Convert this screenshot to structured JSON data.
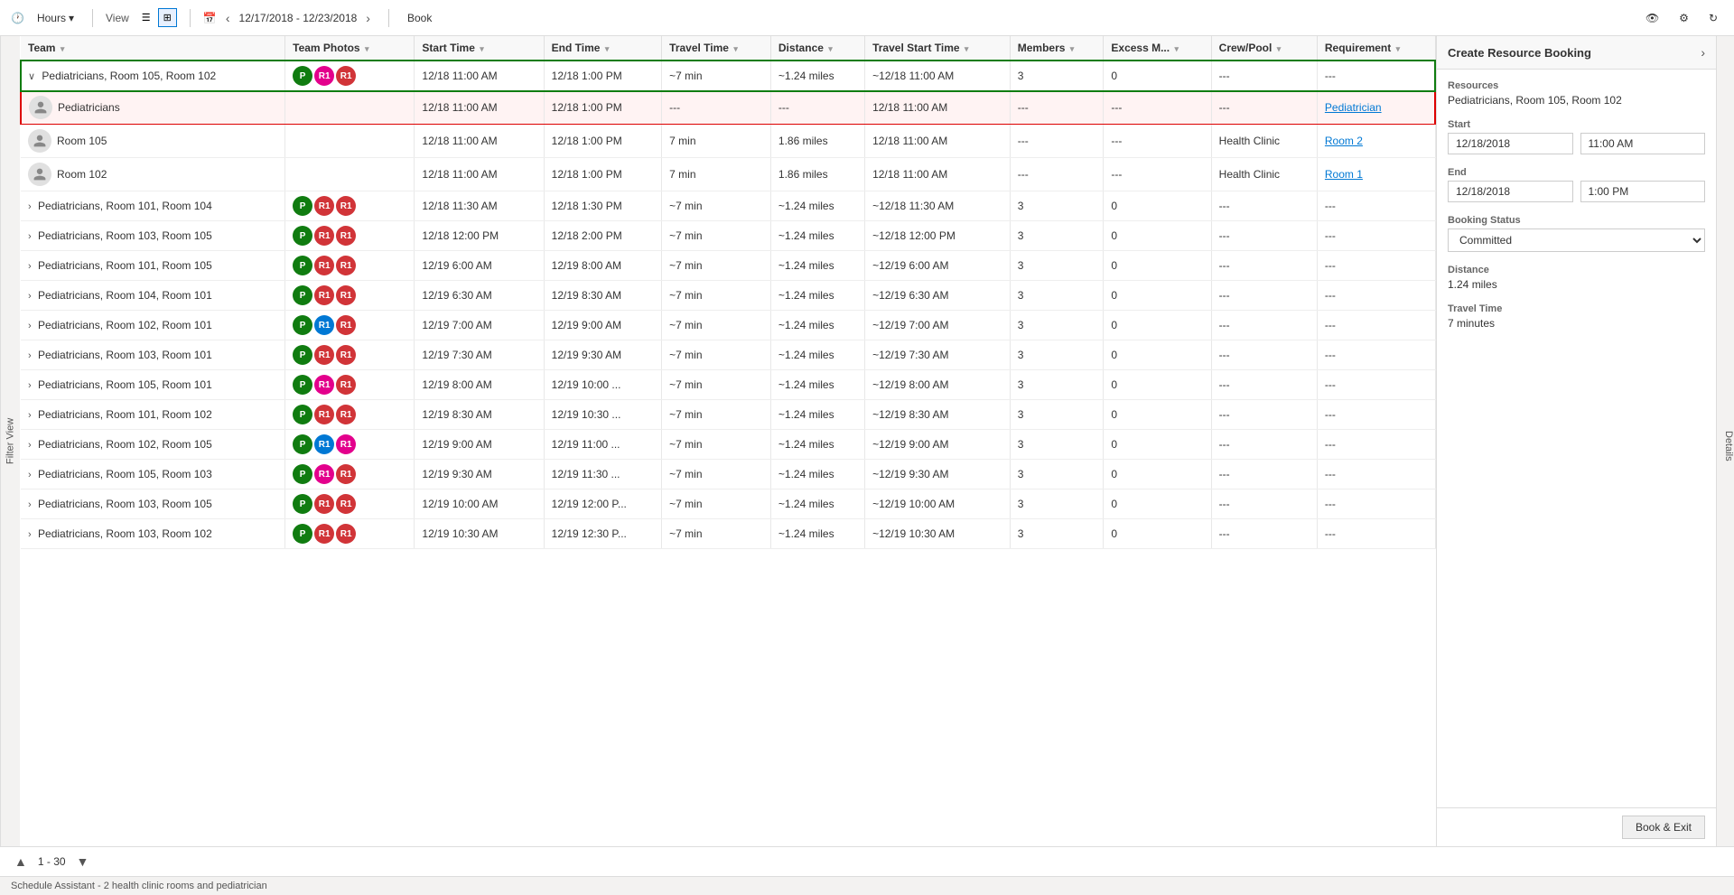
{
  "toolbar": {
    "hours_label": "Hours",
    "view_label": "View",
    "date_range": "12/17/2018 - 12/23/2018",
    "book_label": "Book",
    "eye_icon": "👁",
    "gear_icon": "⚙",
    "refresh_icon": "↻"
  },
  "side_label": "Filter View",
  "columns": [
    {
      "key": "team",
      "label": "Team"
    },
    {
      "key": "photos",
      "label": "Team Photos"
    },
    {
      "key": "start",
      "label": "Start Time"
    },
    {
      "key": "end",
      "label": "End Time"
    },
    {
      "key": "travel",
      "label": "Travel Time"
    },
    {
      "key": "distance",
      "label": "Distance"
    },
    {
      "key": "tstart",
      "label": "Travel Start Time"
    },
    {
      "key": "members",
      "label": "Members"
    },
    {
      "key": "excess",
      "label": "Excess M..."
    },
    {
      "key": "crew",
      "label": "Crew/Pool"
    },
    {
      "key": "req",
      "label": "Requirement"
    }
  ],
  "rows": [
    {
      "id": "row1",
      "type": "group-header",
      "expanded": true,
      "selected": false,
      "team": "Pediatricians, Room 105, Room 102",
      "avatars": [
        {
          "letter": "P",
          "class": "av-green"
        },
        {
          "letter": "R1",
          "class": "av-pink"
        },
        {
          "letter": "R1",
          "class": "av-red"
        }
      ],
      "start": "12/18 11:00 AM",
      "end": "12/18 1:00 PM",
      "travel": "~7 min",
      "distance": "~1.24 miles",
      "tstart": "~12/18 11:00 AM",
      "members": "3",
      "excess": "0",
      "crew": "---",
      "req": "---"
    },
    {
      "id": "row1a",
      "type": "child",
      "selected": true,
      "team": "Pediatricians",
      "avatars": [],
      "avatar_person": true,
      "start": "12/18 11:00 AM",
      "end": "12/18 1:00 PM",
      "travel": "---",
      "distance": "---",
      "tstart": "12/18 11:00 AM",
      "members": "---",
      "excess": "---",
      "crew": "---",
      "req": "Pediatrician",
      "req_link": true
    },
    {
      "id": "row1b",
      "type": "child",
      "selected": false,
      "team": "Room 105",
      "avatars": [],
      "avatar_person": true,
      "start": "12/18 11:00 AM",
      "end": "12/18 1:00 PM",
      "travel": "7 min",
      "distance": "1.86 miles",
      "tstart": "12/18 11:00 AM",
      "members": "---",
      "excess": "---",
      "crew": "Health Clinic",
      "req": "Room 2",
      "req_link": true
    },
    {
      "id": "row1c",
      "type": "child",
      "selected": false,
      "team": "Room 102",
      "avatars": [],
      "avatar_person": true,
      "start": "12/18 11:00 AM",
      "end": "12/18 1:00 PM",
      "travel": "7 min",
      "distance": "1.86 miles",
      "tstart": "12/18 11:00 AM",
      "members": "---",
      "excess": "---",
      "crew": "Health Clinic",
      "req": "Room 1",
      "req_link": true
    },
    {
      "id": "row2",
      "type": "group-header",
      "expanded": false,
      "selected": false,
      "team": "Pediatricians, Room 101, Room 104",
      "avatars": [
        {
          "letter": "P",
          "class": "av-green"
        },
        {
          "letter": "R1",
          "class": "av-red"
        },
        {
          "letter": "R1",
          "class": "av-red"
        }
      ],
      "start": "12/18 11:30 AM",
      "end": "12/18 1:30 PM",
      "travel": "~7 min",
      "distance": "~1.24 miles",
      "tstart": "~12/18 11:30 AM",
      "members": "3",
      "excess": "0",
      "crew": "---",
      "req": "---"
    },
    {
      "id": "row3",
      "type": "group-header",
      "expanded": false,
      "selected": false,
      "team": "Pediatricians, Room 103, Room 105",
      "avatars": [
        {
          "letter": "P",
          "class": "av-green"
        },
        {
          "letter": "R1",
          "class": "av-red"
        },
        {
          "letter": "R1",
          "class": "av-red"
        }
      ],
      "start": "12/18 12:00 PM",
      "end": "12/18 2:00 PM",
      "travel": "~7 min",
      "distance": "~1.24 miles",
      "tstart": "~12/18 12:00 PM",
      "members": "3",
      "excess": "0",
      "crew": "---",
      "req": "---"
    },
    {
      "id": "row4",
      "type": "group-header",
      "expanded": false,
      "selected": false,
      "team": "Pediatricians, Room 101, Room 105",
      "avatars": [
        {
          "letter": "P",
          "class": "av-green"
        },
        {
          "letter": "R1",
          "class": "av-red"
        },
        {
          "letter": "R1",
          "class": "av-red"
        }
      ],
      "start": "12/19 6:00 AM",
      "end": "12/19 8:00 AM",
      "travel": "~7 min",
      "distance": "~1.24 miles",
      "tstart": "~12/19 6:00 AM",
      "members": "3",
      "excess": "0",
      "crew": "---",
      "req": "---"
    },
    {
      "id": "row5",
      "type": "group-header",
      "expanded": false,
      "selected": false,
      "team": "Pediatricians, Room 104, Room 101",
      "avatars": [
        {
          "letter": "P",
          "class": "av-green"
        },
        {
          "letter": "R1",
          "class": "av-red"
        },
        {
          "letter": "R1",
          "class": "av-red"
        }
      ],
      "start": "12/19 6:30 AM",
      "end": "12/19 8:30 AM",
      "travel": "~7 min",
      "distance": "~1.24 miles",
      "tstart": "~12/19 6:30 AM",
      "members": "3",
      "excess": "0",
      "crew": "---",
      "req": "---"
    },
    {
      "id": "row6",
      "type": "group-header",
      "expanded": false,
      "selected": false,
      "team": "Pediatricians, Room 102, Room 101",
      "avatars": [
        {
          "letter": "P",
          "class": "av-green"
        },
        {
          "letter": "R1",
          "class": "av-blue"
        },
        {
          "letter": "R1",
          "class": "av-red"
        }
      ],
      "start": "12/19 7:00 AM",
      "end": "12/19 9:00 AM",
      "travel": "~7 min",
      "distance": "~1.24 miles",
      "tstart": "~12/19 7:00 AM",
      "members": "3",
      "excess": "0",
      "crew": "---",
      "req": "---"
    },
    {
      "id": "row7",
      "type": "group-header",
      "expanded": false,
      "selected": false,
      "team": "Pediatricians, Room 103, Room 101",
      "avatars": [
        {
          "letter": "P",
          "class": "av-green"
        },
        {
          "letter": "R1",
          "class": "av-red"
        },
        {
          "letter": "R1",
          "class": "av-red"
        }
      ],
      "start": "12/19 7:30 AM",
      "end": "12/19 9:30 AM",
      "travel": "~7 min",
      "distance": "~1.24 miles",
      "tstart": "~12/19 7:30 AM",
      "members": "3",
      "excess": "0",
      "crew": "---",
      "req": "---"
    },
    {
      "id": "row8",
      "type": "group-header",
      "expanded": false,
      "selected": false,
      "team": "Pediatricians, Room 105, Room 101",
      "avatars": [
        {
          "letter": "P",
          "class": "av-green"
        },
        {
          "letter": "R1",
          "class": "av-pink"
        },
        {
          "letter": "R1",
          "class": "av-red"
        }
      ],
      "start": "12/19 8:00 AM",
      "end": "12/19 10:00 ...",
      "travel": "~7 min",
      "distance": "~1.24 miles",
      "tstart": "~12/19 8:00 AM",
      "members": "3",
      "excess": "0",
      "crew": "---",
      "req": "---"
    },
    {
      "id": "row9",
      "type": "group-header",
      "expanded": false,
      "selected": false,
      "team": "Pediatricians, Room 101, Room 102",
      "avatars": [
        {
          "letter": "P",
          "class": "av-green"
        },
        {
          "letter": "R1",
          "class": "av-red"
        },
        {
          "letter": "R1",
          "class": "av-red"
        }
      ],
      "start": "12/19 8:30 AM",
      "end": "12/19 10:30 ...",
      "travel": "~7 min",
      "distance": "~1.24 miles",
      "tstart": "~12/19 8:30 AM",
      "members": "3",
      "excess": "0",
      "crew": "---",
      "req": "---"
    },
    {
      "id": "row10",
      "type": "group-header",
      "expanded": false,
      "selected": false,
      "team": "Pediatricians, Room 102, Room 105",
      "avatars": [
        {
          "letter": "P",
          "class": "av-green"
        },
        {
          "letter": "R1",
          "class": "av-blue"
        },
        {
          "letter": "R1",
          "class": "av-pink"
        }
      ],
      "start": "12/19 9:00 AM",
      "end": "12/19 11:00 ...",
      "travel": "~7 min",
      "distance": "~1.24 miles",
      "tstart": "~12/19 9:00 AM",
      "members": "3",
      "excess": "0",
      "crew": "---",
      "req": "---"
    },
    {
      "id": "row11",
      "type": "group-header",
      "expanded": false,
      "selected": false,
      "team": "Pediatricians, Room 105, Room 103",
      "avatars": [
        {
          "letter": "P",
          "class": "av-green"
        },
        {
          "letter": "R1",
          "class": "av-pink"
        },
        {
          "letter": "R1",
          "class": "av-red"
        }
      ],
      "start": "12/19 9:30 AM",
      "end": "12/19 11:30 ...",
      "travel": "~7 min",
      "distance": "~1.24 miles",
      "tstart": "~12/19 9:30 AM",
      "members": "3",
      "excess": "0",
      "crew": "---",
      "req": "---"
    },
    {
      "id": "row12",
      "type": "group-header",
      "expanded": false,
      "selected": false,
      "team": "Pediatricians, Room 103, Room 105",
      "avatars": [
        {
          "letter": "P",
          "class": "av-green"
        },
        {
          "letter": "R1",
          "class": "av-red"
        },
        {
          "letter": "R1",
          "class": "av-red"
        }
      ],
      "start": "12/19 10:00 AM",
      "end": "12/19 12:00 P...",
      "travel": "~7 min",
      "distance": "~1.24 miles",
      "tstart": "~12/19 10:00 AM",
      "members": "3",
      "excess": "0",
      "crew": "---",
      "req": "---"
    },
    {
      "id": "row13",
      "type": "group-header",
      "expanded": false,
      "selected": false,
      "team": "Pediatricians, Room 103, Room 102",
      "avatars": [
        {
          "letter": "P",
          "class": "av-green"
        },
        {
          "letter": "R1",
          "class": "av-red"
        },
        {
          "letter": "R1",
          "class": "av-red"
        }
      ],
      "start": "12/19 10:30 AM",
      "end": "12/19 12:30 P...",
      "travel": "~7 min",
      "distance": "~1.24 miles",
      "tstart": "~12/19 10:30 AM",
      "members": "3",
      "excess": "0",
      "crew": "---",
      "req": "---"
    }
  ],
  "pagination": {
    "range": "1 - 30",
    "prev_icon": "▲",
    "next_icon": "▼"
  },
  "status_bar": "Schedule Assistant - 2 health clinic rooms and pediatrician",
  "right_panel": {
    "title": "Create Resource Booking",
    "arrow_icon": "›",
    "resources_label": "Resources",
    "resources_value": "Pediatricians, Room 105, Room 102",
    "start_label": "Start",
    "start_date": "12/18/2018",
    "start_time": "11:00 AM",
    "end_label": "End",
    "end_date": "12/18/2018",
    "end_time": "1:00 PM",
    "booking_status_label": "Booking Status",
    "booking_status_value": "Committed",
    "distance_label": "Distance",
    "distance_value": "1.24 miles",
    "travel_time_label": "Travel Time",
    "travel_time_value": "7 minutes",
    "book_exit_label": "Book & Exit"
  },
  "details_tab": "Details"
}
